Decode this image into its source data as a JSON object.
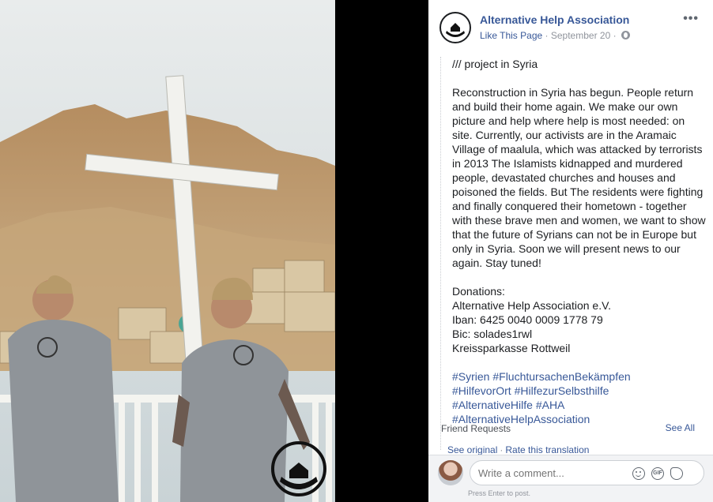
{
  "post": {
    "page_name": "Alternative Help Association",
    "like_label": "Like This Page",
    "separator": "·",
    "date": "September 20",
    "heading": "/// project in Syria",
    "paragraph": "Reconstruction in Syria has begun. People return and build their home again. We make our own picture and help where help is most needed: on site. Currently, our activists are in the Aramaic Village of maalula, which was attacked by terrorists in 2013 The Islamists kidnapped and murdered people, devastated churches and houses and poisoned the fields. But The residents were fighting and finally conquered their hometown - together with these brave men and women, we want to show that the future of Syrians can not be in Europe but only in Syria. Soon we will present news to our again. Stay tuned!",
    "donations": [
      "Donations:",
      "Alternative Help Association e.V.",
      "Iban: 6425 0040 0009 1778 79",
      "Bic: solades1rwl",
      "Kreissparkasse Rottweil"
    ],
    "hashtags": [
      "#Syrien #FluchtursachenBekämpfen",
      "#HilfevorOrt #HilfezurSelbsthilfe",
      "#AlternativeHilfe #AHA",
      "#AlternativeHelpAssociation"
    ]
  },
  "chat_overlay": {
    "friend_requests": "Friend Requests",
    "see_all": "See All"
  },
  "translation": {
    "see_original": "See original",
    "dot": "·",
    "rate": "Rate this translation"
  },
  "comment": {
    "placeholder": "Write a comment...",
    "gif_label": "GIF",
    "hint": "Press Enter to post."
  },
  "icons": {
    "more": "more-options-icon",
    "globe": "globe-icon",
    "emoji": "emoji-icon",
    "gif": "gif-icon",
    "sticker": "sticker-icon",
    "watermark": "house-hands-logo"
  },
  "colors": {
    "link": "#385898",
    "text": "#1c1e21",
    "muted": "#90949c"
  }
}
